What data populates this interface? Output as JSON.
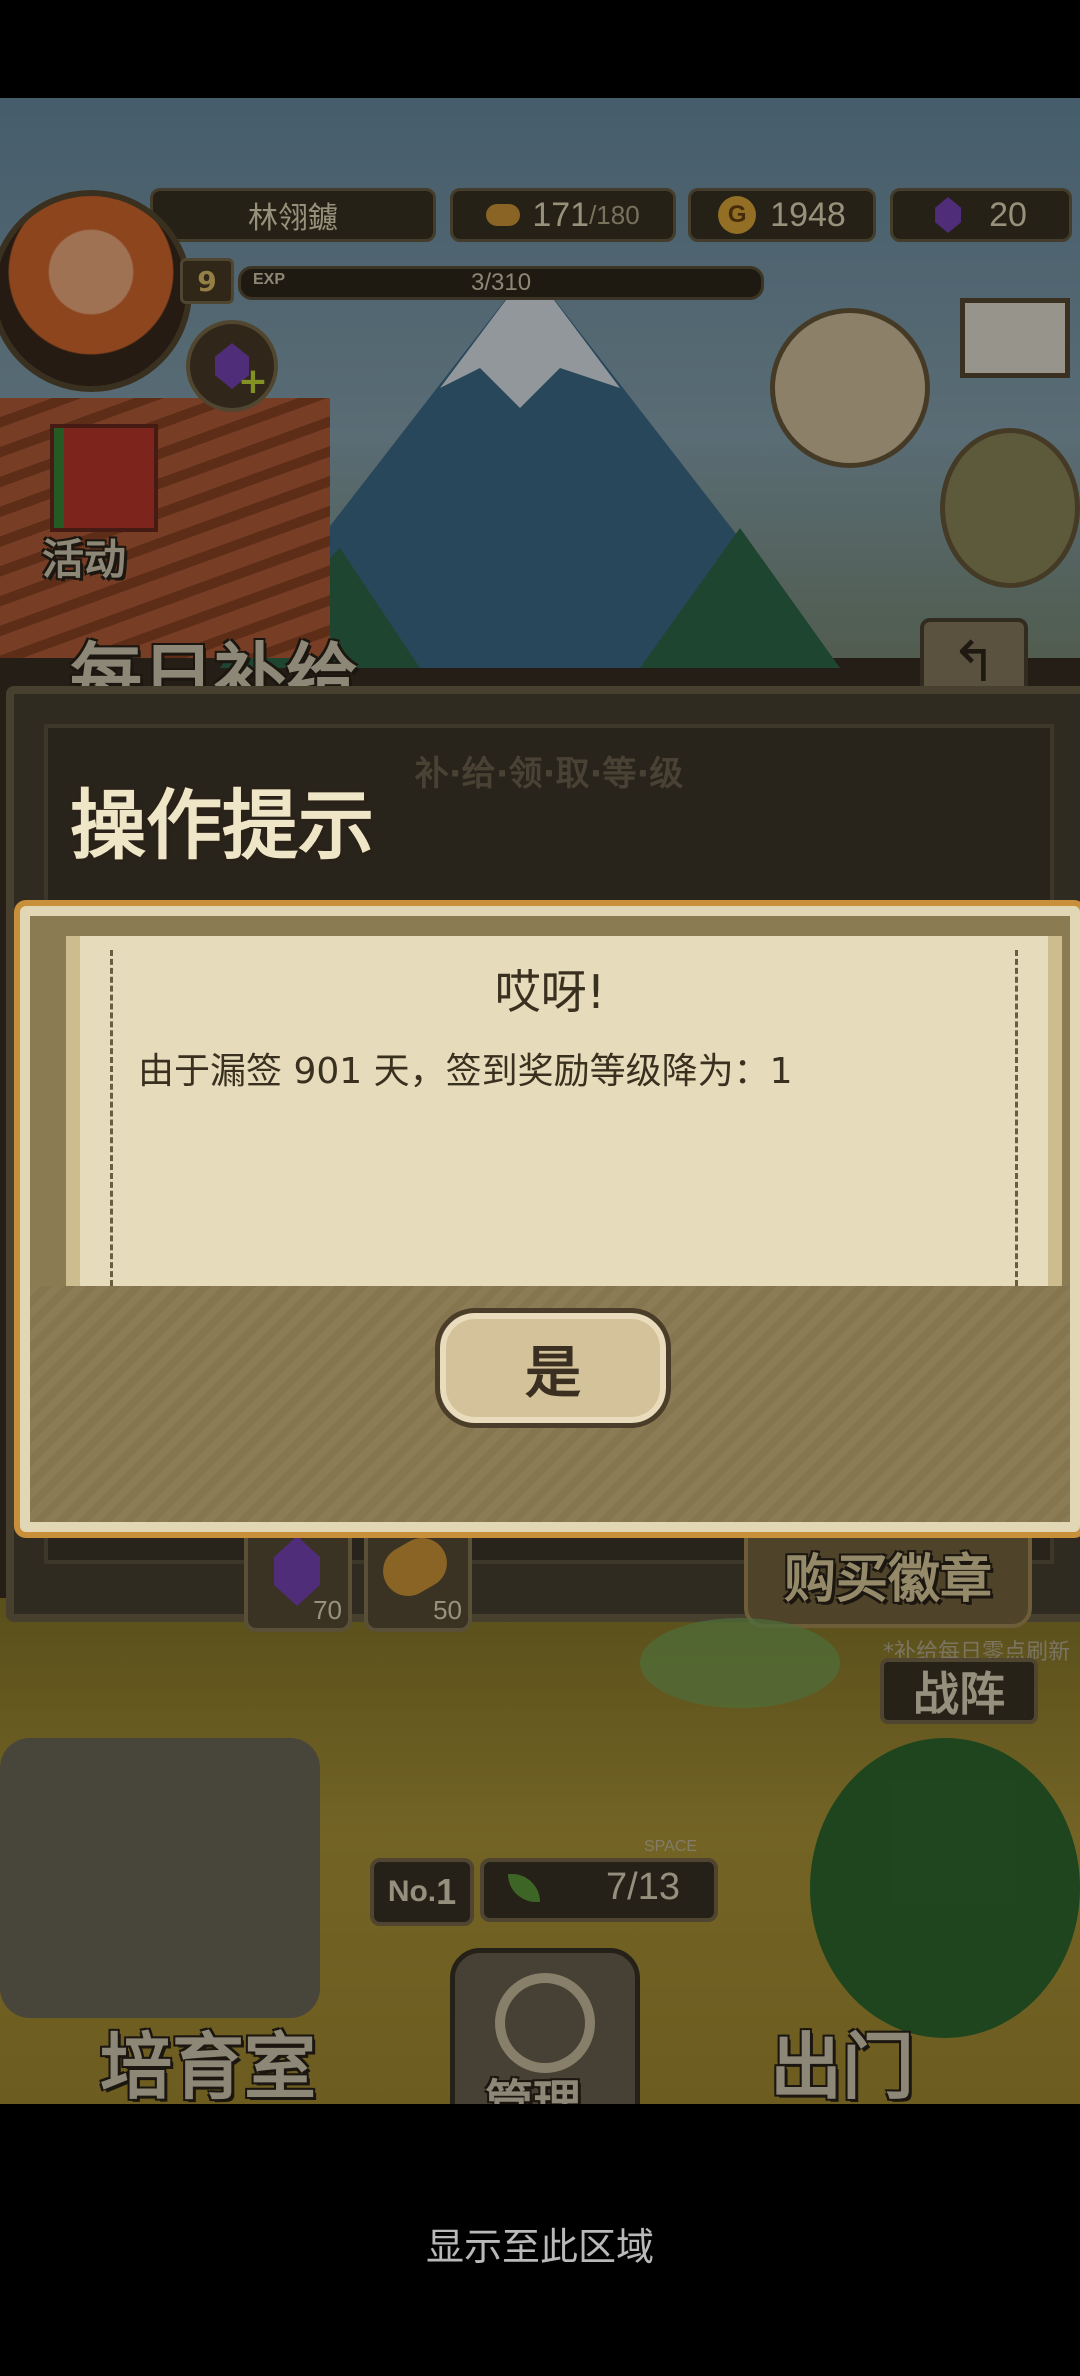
{
  "player": {
    "name": "林翎鑢",
    "level": "9",
    "exp_label": "EXP",
    "exp": "3/310"
  },
  "resources": {
    "stamina": "171",
    "stamina_max": "/180",
    "gold_symbol": "G",
    "gold": "1948",
    "gems": "20"
  },
  "side_buttons": {
    "activity": "活动"
  },
  "supply_panel": {
    "title": "每日补给",
    "subtitle": "补·给·领·取·等·级",
    "rewards": [
      {
        "icon": "gem-icon",
        "count": "70"
      },
      {
        "icon": "bread-icon",
        "count": "50"
      }
    ],
    "buy_badge": "购买徽章",
    "refresh_note": "*补给每日零点刷新"
  },
  "dialog": {
    "header": "操作提示",
    "title": "哎呀!",
    "message": "由于漏签 901 天，签到奖励等级降为：1",
    "confirm": "是"
  },
  "bottom": {
    "formation": "战阵",
    "rank_prefix": "No.",
    "rank": "1",
    "space_label": "SPACE",
    "space": "7/13",
    "nursery": "培育室",
    "manage": "管理",
    "go_out": "出门"
  },
  "system_hint": "显示至此区域"
}
